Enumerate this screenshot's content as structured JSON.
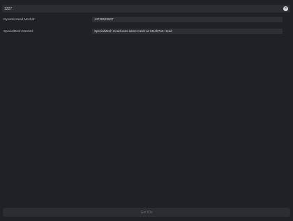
{
  "search": {
    "value": "1227",
    "clear_icon": "×"
  },
  "fields": [
    {
      "label": "DynamicHead MeshId:",
      "value": "14726529507"
    },
    {
      "label": "SpecialMesh MeshId:",
      "value": "SpecialMesh Head uses same mesh as MeshPart Head"
    }
  ],
  "actions": {
    "get_ids_label": "Get IDs"
  },
  "colors": {
    "background": "#202126",
    "field_bg": "#2e2f35",
    "button_bg": "#2c2d32"
  }
}
